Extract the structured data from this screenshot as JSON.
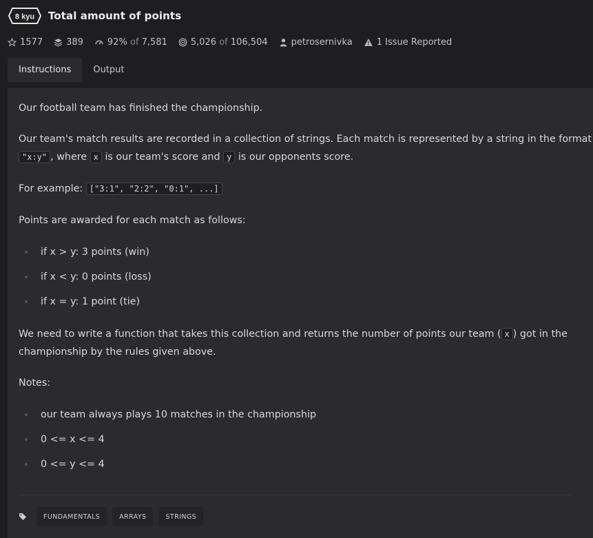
{
  "kata": {
    "rank": "8 kyu",
    "title": "Total amount of points"
  },
  "stats": {
    "stars": "1577",
    "collections": "389",
    "satisfaction_pct": "92%",
    "satisfaction_of": "of",
    "satisfaction_total": "7,581",
    "completed": "5,026",
    "completed_of": "of",
    "completed_total": "106,504",
    "author": "petrosernivka",
    "issues": "1 Issue Reported"
  },
  "tabs": [
    {
      "label": "Instructions",
      "active": true
    },
    {
      "label": "Output",
      "active": false
    }
  ],
  "description": {
    "p1": "Our football team has finished the championship.",
    "p2_line1": "Our team's match results are recorded in a collection of strings. Each match is represented by a string in the format",
    "p2_code1": "\"x:y\"",
    "p2_text_a": ", where",
    "p2_code2": "x",
    "p2_text_b": "is our team's score and",
    "p2_code3": "y",
    "p2_text_c": "is our opponents score.",
    "p3_text": "For example:",
    "p3_code": "[\"3:1\", \"2:2\", \"0:1\", ...]",
    "p4": "Points are awarded for each match as follows:",
    "rules": [
      "if x > y: 3 points (win)",
      "if x < y: 0 points (loss)",
      "if x = y: 1 point (tie)"
    ],
    "p5_text_a": "We need to write a function that takes this collection and returns the number of points our team (",
    "p5_code": "x",
    "p5_text_b": ") got in the",
    "p5_line2": "championship by the rules given above.",
    "notes_label": "Notes:",
    "notes": [
      "our team always plays 10 matches in the championship",
      "0 <= x <= 4",
      "0 <= y <= 4"
    ]
  },
  "tags": [
    "FUNDAMENTALS",
    "ARRAYS",
    "STRINGS"
  ],
  "icons": {
    "star": "star-icon",
    "collections": "stack-icon",
    "satisfaction": "gauge-icon",
    "completed": "target-icon",
    "author": "user-icon",
    "issues": "warning-icon",
    "tags": "tag-icon"
  },
  "colors": {
    "background": "#1e1e20",
    "panel": "#2b2b2e",
    "text": "#d8d8d8"
  }
}
